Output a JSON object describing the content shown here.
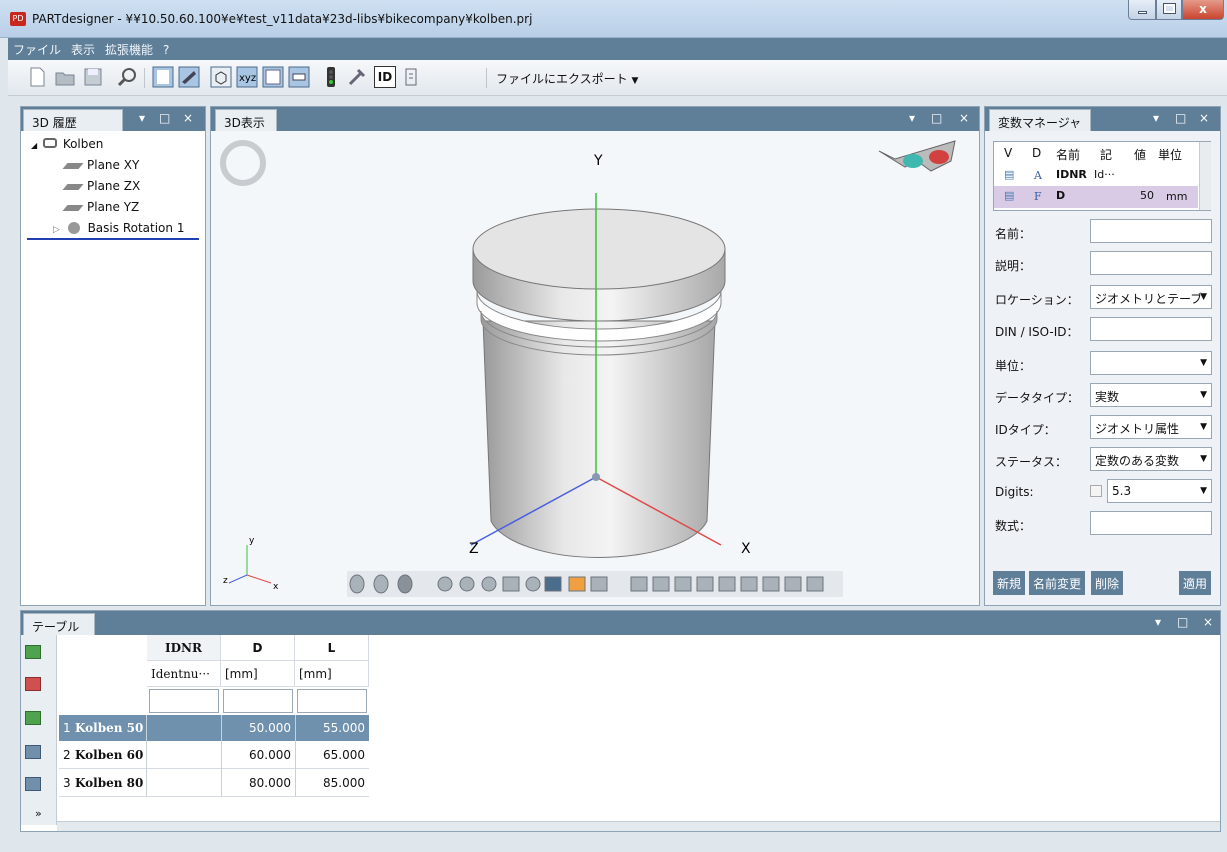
{
  "window": {
    "title": "PARTdesigner - ¥¥10.50.60.100¥e¥test_v11data¥23d-libs¥bikecompany¥kolben.prj",
    "app_icon": "PD",
    "close": "x"
  },
  "menu": [
    "ファイル",
    "表示",
    "拡張機能",
    "?"
  ],
  "toolbar": {
    "export_label": "ファイルにエクスポート",
    "id_label": "ID"
  },
  "history": {
    "tab": "3D 履歴",
    "tree": [
      {
        "label": "Kolben",
        "icon": "assembly-icon",
        "expander": "◢"
      },
      {
        "label": "Plane XY",
        "icon": "plane-icon"
      },
      {
        "label": "Plane ZX",
        "icon": "plane-icon"
      },
      {
        "label": "Plane YZ",
        "icon": "plane-icon"
      },
      {
        "label": "Basis Rotation 1",
        "icon": "rotation-body-icon",
        "expander": "▷"
      }
    ]
  },
  "view3d": {
    "tab": "3D表示",
    "axis_y": "Y",
    "axis_x": "X",
    "axis_z": "Z",
    "mini_axes": {
      "y": "y",
      "x": "x",
      "z": "z"
    }
  },
  "varman": {
    "tab": "変数マネージャ",
    "columns": [
      "V",
      "D",
      "名前",
      "記",
      "値",
      "単位"
    ],
    "rows": [
      {
        "v": "▤",
        "d": "A",
        "name": "IDNR",
        "desc": "Id···",
        "value": "",
        "unit": ""
      },
      {
        "v": "▤",
        "d": "F",
        "name": "D",
        "desc": "",
        "value": "50",
        "unit": "mm"
      }
    ],
    "fields": {
      "name_label": "名前：",
      "name_value": "",
      "desc_label": "説明：",
      "desc_value": "",
      "location_label": "ロケーション：",
      "location_value": "ジオメトリとテーブ",
      "din_label": "DIN / ISO-ID：",
      "din_value": "",
      "unit_label": "単位：",
      "unit_value": "",
      "datatype_label": "データタイプ：",
      "datatype_value": "実数",
      "idtype_label": "IDタイプ：",
      "idtype_value": "ジオメトリ属性",
      "status_label": "ステータス：",
      "status_value": "定数のある変数",
      "digits_label": "Digits:",
      "digits_value": "5.3",
      "formula_label": "数式：",
      "formula_value": ""
    },
    "buttons": {
      "new": "新規",
      "rename": "名前変更",
      "delete": "削除",
      "apply": "適用"
    }
  },
  "table": {
    "tab": "テーブル",
    "columns": [
      {
        "name": "IDNR",
        "desc": "Identnu···"
      },
      {
        "name": "D",
        "desc": "[mm]"
      },
      {
        "name": "L",
        "desc": "[mm]"
      }
    ],
    "rows": [
      {
        "num": "1",
        "label": "Kolben 50",
        "idnr": "",
        "d": "50.000",
        "l": "55.000"
      },
      {
        "num": "2",
        "label": "Kolben 60",
        "idnr": "",
        "d": "60.000",
        "l": "65.000"
      },
      {
        "num": "3",
        "label": "Kolben 80",
        "idnr": "",
        "d": "80.000",
        "l": "85.000"
      }
    ],
    "more": "»"
  },
  "pane_controls": {
    "pin": "▾",
    "max": "□",
    "close": "×"
  },
  "colors": {
    "header": "#5f7e98",
    "selected_row": "#6f91ad",
    "accent": "#1f3fb3"
  }
}
